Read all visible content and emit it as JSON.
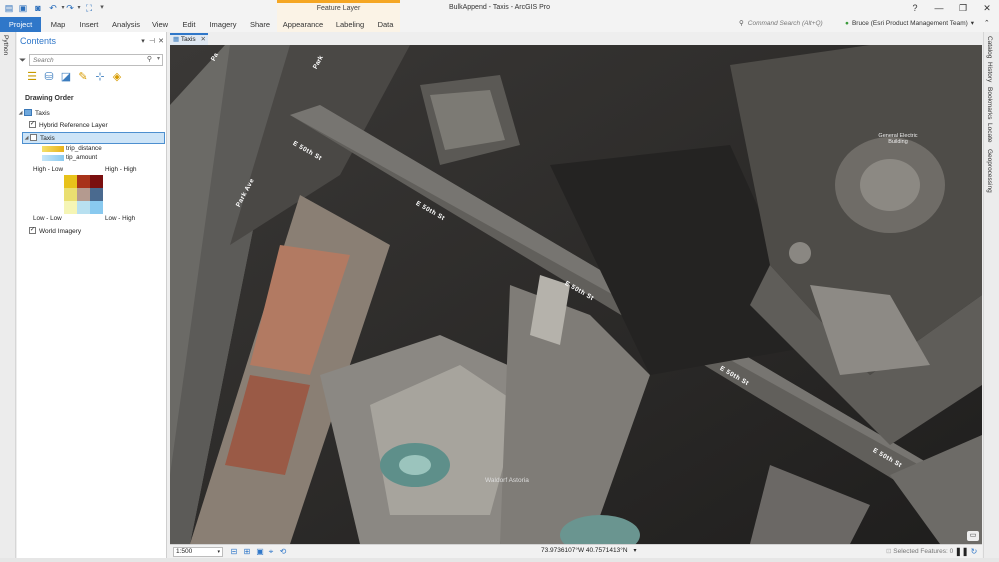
{
  "app": {
    "title": "BulkAppend - Taxis - ArcGIS Pro",
    "contextual_group": "Feature Layer",
    "window_controls": [
      "?",
      "—",
      "❐",
      "✕"
    ]
  },
  "ribbon": {
    "tabs": [
      "Project",
      "Map",
      "Insert",
      "Analysis",
      "View",
      "Edit",
      "Imagery",
      "Share",
      "Appearance",
      "Labeling",
      "Data"
    ],
    "command_search_placeholder": "Command Search (Alt+Q)",
    "user": "Bruce (Esri Product Management Team)"
  },
  "left_strip": {
    "tabs": [
      "Python"
    ]
  },
  "right_strip": {
    "tabs": [
      "Catalog",
      "History",
      "Bookmarks",
      "Locate",
      "Geoprocessing"
    ]
  },
  "contents": {
    "title": "Contents",
    "search_placeholder": "Search",
    "drawing_order": "Drawing Order",
    "map_name": "Taxis",
    "layers": {
      "hybrid": "Hybrid Reference Layer",
      "taxis": "Taxis",
      "world": "World Imagery"
    },
    "legend": {
      "field_1": "trip_distance",
      "field_2": "tip_amount",
      "high_low": "High - Low",
      "high_high": "High - High",
      "low_low": "Low - Low",
      "low_high": "Low - High",
      "colors": {
        "field_1": "#e8b21a",
        "field_2": "#89c9ef",
        "grid": [
          [
            "#e8c21a",
            "#a8331a",
            "#7a0f0f"
          ],
          [
            "#eadf70",
            "#b49a8f",
            "#4a6a8f"
          ],
          [
            "#f5f5b5",
            "#b8e0f0",
            "#89c9ef"
          ]
        ]
      }
    }
  },
  "map_view": {
    "tab_label": "Taxis",
    "labels": {
      "street_1": "E 50th St",
      "street_2": "E 50th St",
      "street_3": "E 50th St",
      "street_4": "E 50th St",
      "street_5": "E 50th St",
      "avenue_1": "Park Ave",
      "avenue_2": "Park",
      "avenue_3": "Pa",
      "building_1": "Waldorf Astoria",
      "building_2": "General Electric Building"
    }
  },
  "statusbar": {
    "scale": "1:500",
    "coordinates": "73.9736107°W 40.7571413°N",
    "selected_features": "Selected Features: 0"
  }
}
